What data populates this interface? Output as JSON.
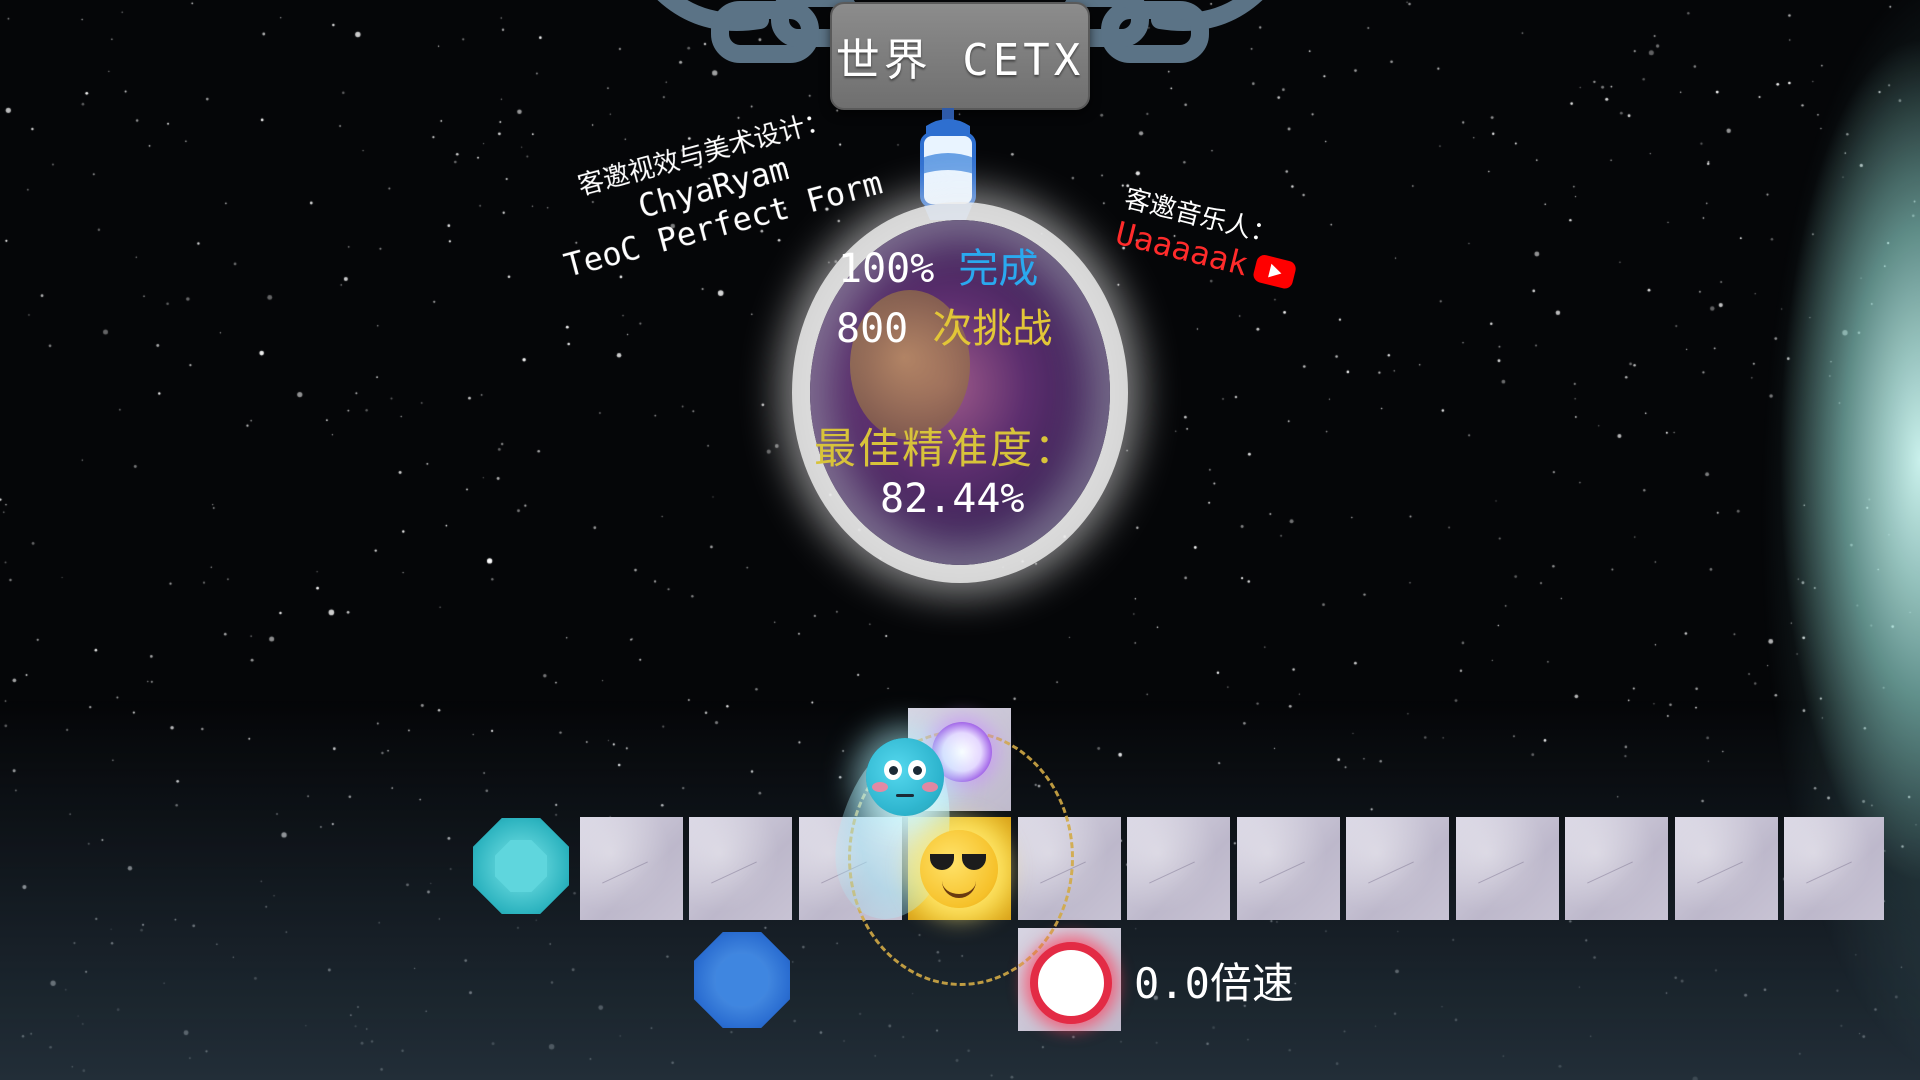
{
  "level": {
    "title": "世界 CETX"
  },
  "stats": {
    "completion_value": "100%",
    "completion_label": "完成",
    "attempts_value": "800",
    "attempts_label": "次挑战",
    "best_accuracy_label": "最佳精准度：",
    "best_accuracy_value": "82.44%"
  },
  "credits": {
    "visual_heading": "客邀视效与美术设计：",
    "visual_artist": "ChyaRyam",
    "visual_subtitle": "TeoC Perfect Form",
    "music_heading": "客邀音乐人：",
    "music_artist": "Uaaaaak"
  },
  "playback": {
    "speed_label": "0.0倍速"
  },
  "icons": {
    "lantern": "lantern-icon",
    "youtube": "youtube-icon",
    "cyan_gem": "cyan-gem-icon",
    "blue_gem": "blue-gem-icon",
    "ice_planet": "ice-planet-flushed-icon",
    "fire_planet": "fire-planet-sunglasses-icon",
    "purple_orb": "purple-orb-icon",
    "red_orb": "red-record-orb-icon"
  },
  "colors": {
    "completion_accent": "#2aa9ef",
    "attempts_accent": "#e2c637",
    "accuracy_label": "#d8c33a",
    "music_artist": "#ff2b2b"
  }
}
